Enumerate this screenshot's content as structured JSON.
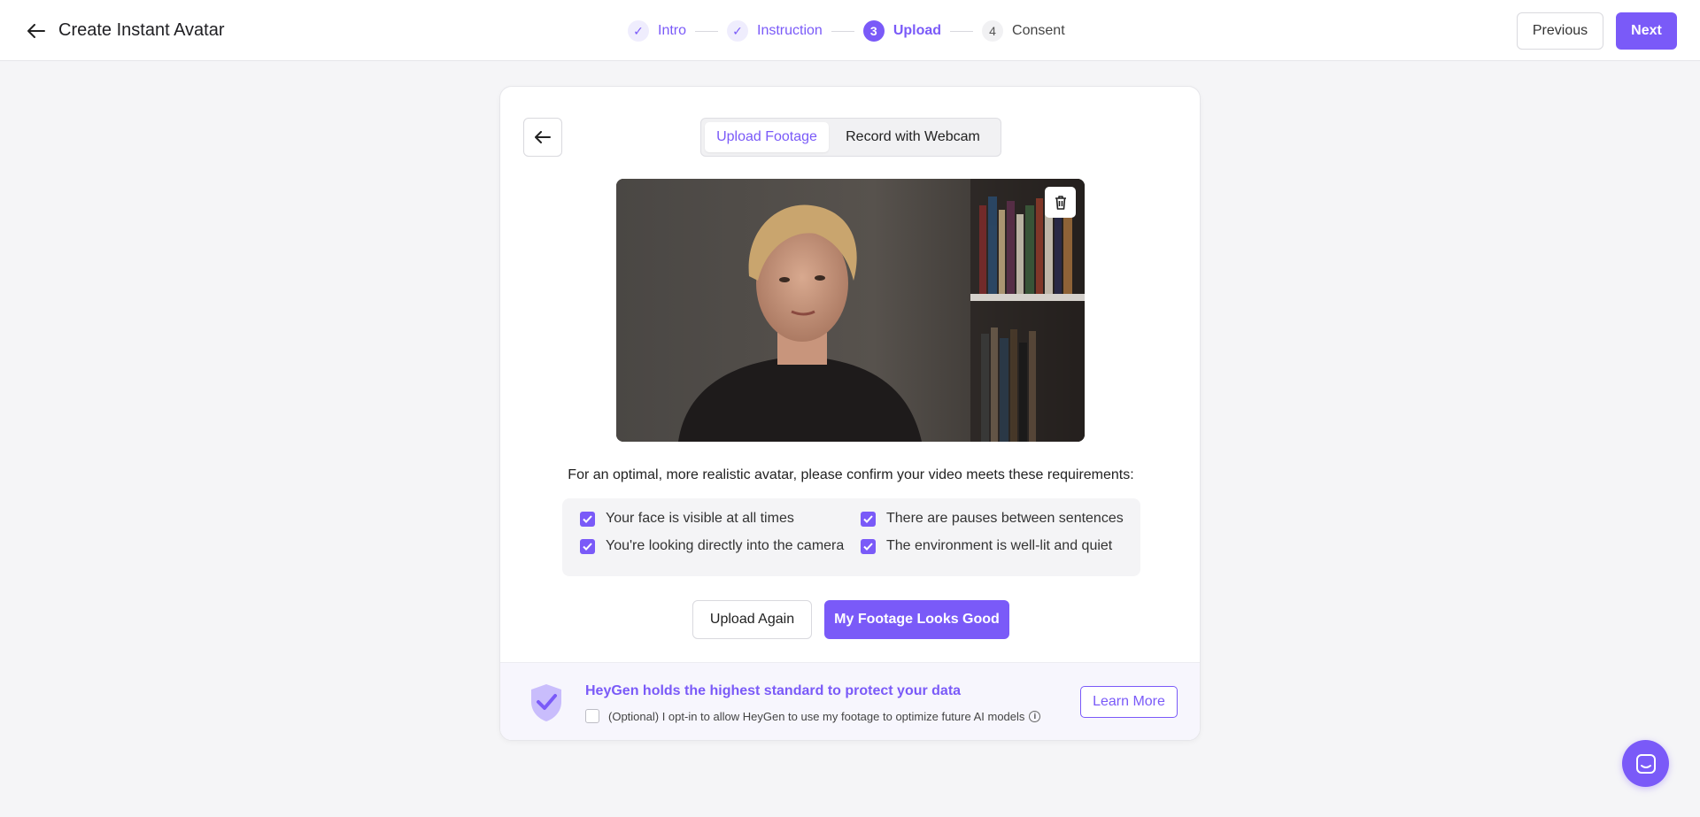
{
  "header": {
    "title": "Create Instant Avatar",
    "steps": [
      {
        "marker": "✓",
        "label": "Intro",
        "state": "done"
      },
      {
        "marker": "✓",
        "label": "Instruction",
        "state": "done"
      },
      {
        "marker": "3",
        "label": "Upload",
        "state": "active"
      },
      {
        "marker": "4",
        "label": "Consent",
        "state": "todo"
      }
    ],
    "previous_label": "Previous",
    "next_label": "Next"
  },
  "upload": {
    "tabs": [
      {
        "label": "Upload Footage",
        "selected": true
      },
      {
        "label": "Record with Webcam",
        "selected": false
      }
    ],
    "requirements_intro": "For an optimal, more realistic avatar, please confirm your video meets these requirements:",
    "requirements": [
      {
        "label": "Your face is visible at all times",
        "checked": true
      },
      {
        "label": "There are pauses between sentences",
        "checked": true
      },
      {
        "label": "You're looking directly into the camera",
        "checked": true
      },
      {
        "label": "The environment is well-lit and quiet",
        "checked": true
      }
    ],
    "upload_again_label": "Upload Again",
    "confirm_label": "My Footage Looks Good"
  },
  "footer": {
    "title": "HeyGen holds the highest standard to protect your data",
    "optin_label": "(Optional) I opt-in to allow HeyGen to use my footage to optimize future AI models",
    "optin_checked": false,
    "learn_more_label": "Learn More"
  },
  "colors": {
    "accent": "#7a5af8",
    "background": "#f5f5f7"
  }
}
